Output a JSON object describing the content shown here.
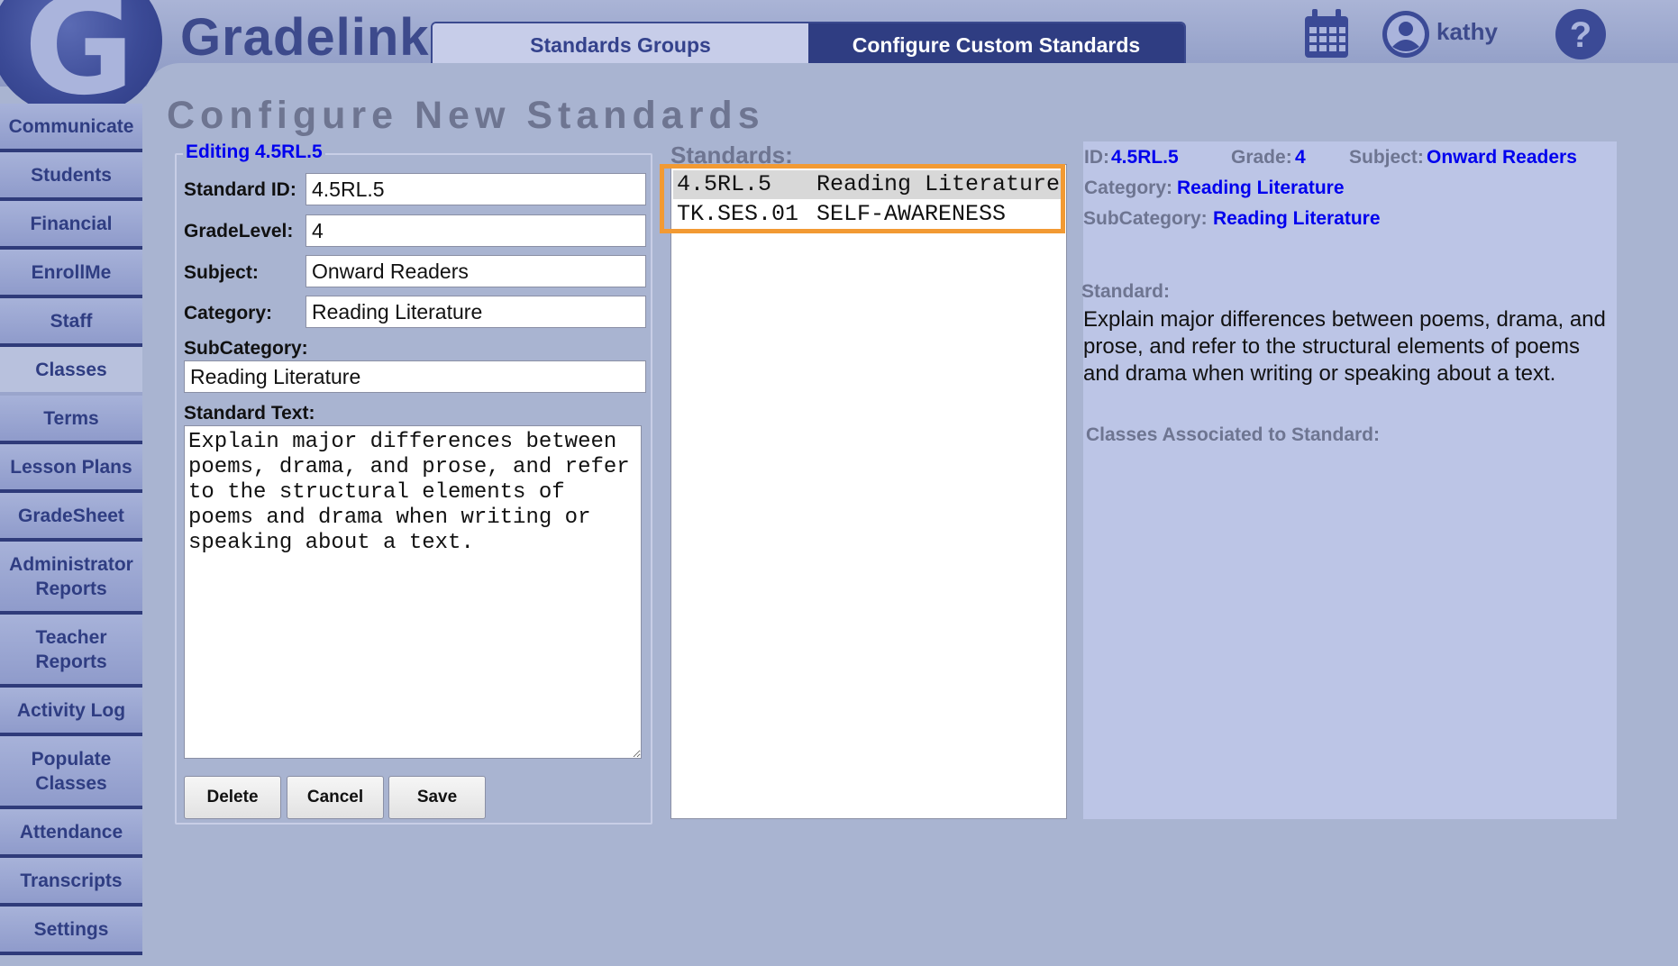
{
  "brand": {
    "name": "Gradelink"
  },
  "header": {
    "tabs": [
      {
        "label": "Standards Groups"
      },
      {
        "label": "Configure Custom Standards"
      }
    ],
    "username": "kathy"
  },
  "sidebar": {
    "items": [
      {
        "label": "Communicate"
      },
      {
        "label": "Students"
      },
      {
        "label": "Financial"
      },
      {
        "label": "EnrollMe"
      },
      {
        "label": "Staff"
      },
      {
        "label": "Classes"
      },
      {
        "label": "Terms"
      },
      {
        "label": "Lesson Plans"
      },
      {
        "label": "GradeSheet"
      },
      {
        "label": "Administrator Reports"
      },
      {
        "label": "Teacher Reports"
      },
      {
        "label": "Activity Log"
      },
      {
        "label": "Populate Classes"
      },
      {
        "label": "Attendance"
      },
      {
        "label": "Transcripts"
      },
      {
        "label": "Settings"
      }
    ]
  },
  "page": {
    "title": "Configure New Standards"
  },
  "editor": {
    "legend": "Editing 4.5RL.5",
    "standard_id_label": "Standard ID:",
    "standard_id": "4.5RL.5",
    "grade_label": "GradeLevel:",
    "grade": "4",
    "subject_label": "Subject:",
    "subject": "Onward Readers",
    "category_label": "Category:",
    "category": "Reading Literature",
    "subcategory_label": "SubCategory:",
    "subcategory": "Reading Literature",
    "text_label": "Standard Text:",
    "text": "Explain major differences between poems, drama, and prose, and refer to the structural elements of poems and drama when writing or speaking about a text.",
    "buttons": {
      "delete": "Delete",
      "cancel": "Cancel",
      "save": "Save"
    }
  },
  "standards": {
    "title": "Standards:",
    "rows": [
      {
        "id": "4.5RL.5",
        "name": "Reading Literature",
        "selected": true
      },
      {
        "id": "TK.SES.01",
        "name": "SELF-AWARENESS",
        "selected": false
      }
    ]
  },
  "detail": {
    "id_label": "ID:",
    "id": "4.5RL.5",
    "grade_label": "Grade:",
    "grade": "4",
    "subject_label": "Subject:",
    "subject": "Onward Readers",
    "category_label": "Category:",
    "category": "Reading Literature",
    "subcategory_label": "SubCategory:",
    "subcategory": "Reading Literature",
    "standard_label": "Standard:",
    "standard_text": "Explain major differences between poems, drama, and prose, and refer to the structural elements of poems and drama when writing or speaking about a text.",
    "classes_label": "Classes Associated to Standard:"
  },
  "colors": {
    "highlight": "#f29a33",
    "link": "#0000ee",
    "nav_dark": "#2f3d82"
  }
}
